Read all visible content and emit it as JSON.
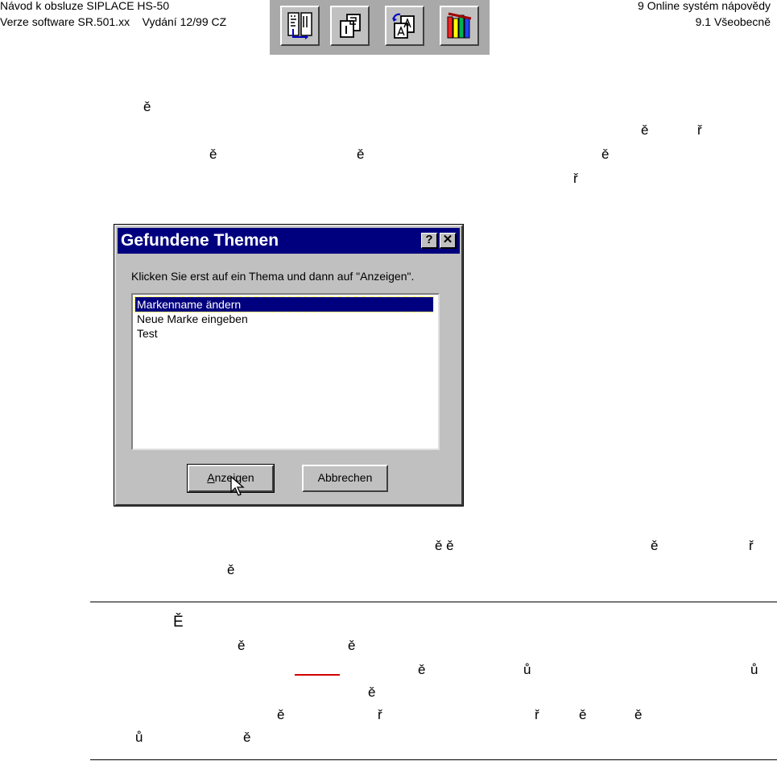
{
  "header": {
    "left_line1": "Návod k obsluze SIPLACE HS-50",
    "left_line2": "Verze software SR.501.xx    Vydání 12/99 CZ",
    "right_line1": "9 Online systém nápovědy",
    "right_line2": "9.1 Všeobecně"
  },
  "toolbar": {
    "icons": [
      "contents-icon",
      "index-icon",
      "find-icon",
      "library-icon"
    ]
  },
  "stray": {
    "e_caron": "ě",
    "r_caron": "ř",
    "E_caron": "Ě",
    "u_ring": "ů",
    "e_pair": "ě ě"
  },
  "dialog": {
    "title": "Gefundene Themen",
    "help_btn": "?",
    "close_btn": "✕",
    "instruction": "Klicken Sie erst auf ein Thema und dann auf \"Anzeigen\".",
    "topics": [
      "Markenname ändern",
      "Neue Marke eingeben",
      "Test"
    ],
    "selected_index": 0,
    "show_btn_accel": "A",
    "show_btn_rest": "nzeigen",
    "cancel_btn": "Abbrechen"
  },
  "colors": {
    "titlebar": "#00007f",
    "dialog_face": "#c0c0c0",
    "toolbar_bg": "#a9a9a9",
    "red_underline": "#d40000"
  }
}
